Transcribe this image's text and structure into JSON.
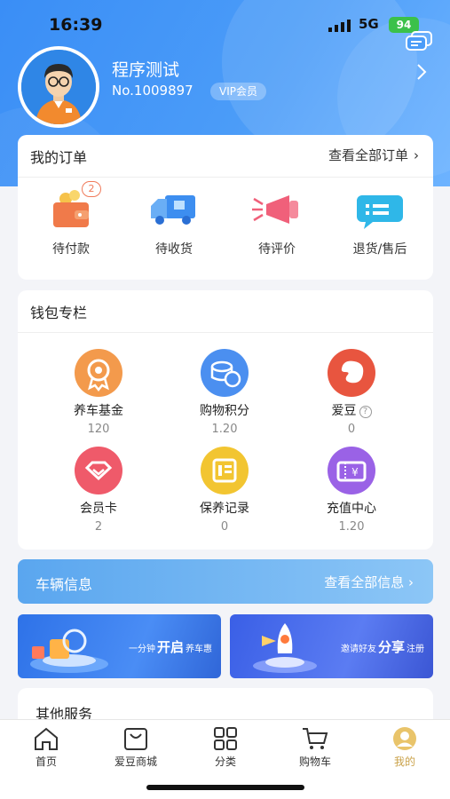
{
  "status_bar": {
    "time": "16:39",
    "network": "5G",
    "battery": "94"
  },
  "profile": {
    "name": "程序测试",
    "number": "No.1009897",
    "vip_badge": "VIP会员"
  },
  "orders": {
    "title": "我的订单",
    "view_all": "查看全部订单",
    "items": [
      {
        "label": "待付款",
        "badge": "2",
        "icon": "wallet-icon"
      },
      {
        "label": "待收货",
        "icon": "truck-icon"
      },
      {
        "label": "待评价",
        "icon": "megaphone-icon"
      },
      {
        "label": "退货/售后",
        "icon": "service-chat-icon"
      }
    ]
  },
  "wallet": {
    "title": "钱包专栏",
    "items": [
      {
        "label": "养车基金",
        "value": "120",
        "icon": "medal-icon",
        "color": "#f39a4c"
      },
      {
        "label": "购物积分",
        "value": "1.20",
        "icon": "coins-icon",
        "color": "#4b8ff0"
      },
      {
        "label": "爱豆",
        "value": "0",
        "icon": "bean-icon",
        "color": "#e8553f"
      },
      {
        "label": "会员卡",
        "value": "2",
        "icon": "diamond-card-icon",
        "color": "#ef5a6a"
      },
      {
        "label": "保养记录",
        "value": "0",
        "icon": "record-icon",
        "color": "#f2c531"
      },
      {
        "label": "充值中心",
        "value": "1.20",
        "icon": "recharge-icon",
        "color": "#9a62e6"
      }
    ]
  },
  "vehicle": {
    "title": "车辆信息",
    "view_all": "查看全部信息"
  },
  "banners": [
    {
      "pre": "一分钟",
      "bold": "开启",
      "post": "养车惠"
    },
    {
      "pre": "邀请好友",
      "bold": "分享",
      "post": "注册"
    }
  ],
  "other_services": {
    "title": "其他服务"
  },
  "tabbar": {
    "items": [
      {
        "label": "首页",
        "icon": "home-icon"
      },
      {
        "label": "爱豆商城",
        "icon": "shop-bag-icon"
      },
      {
        "label": "分类",
        "icon": "grid-icon"
      },
      {
        "label": "购物车",
        "icon": "cart-icon"
      },
      {
        "label": "我的",
        "icon": "profile-icon"
      }
    ],
    "active_color": "#caa24a"
  }
}
